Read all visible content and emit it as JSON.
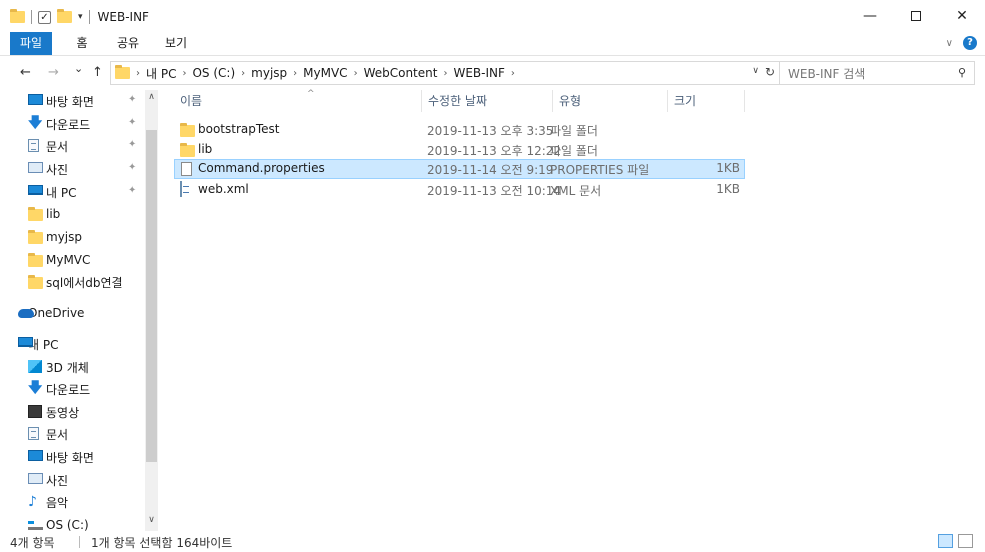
{
  "window": {
    "title": "WEB-INF",
    "minimize_label": "—",
    "maximize_label": "",
    "close_label": "✕",
    "qat_dropdown_glyph": "▾"
  },
  "ribbon": {
    "tabs": [
      {
        "label": "파일",
        "active": true
      },
      {
        "label": "홈",
        "active": false
      },
      {
        "label": "공유",
        "active": false
      },
      {
        "label": "보기",
        "active": false
      }
    ],
    "expand_glyph": "∨",
    "help_glyph": "?"
  },
  "navigation": {
    "back": "←",
    "forward": "→",
    "recent": "⌄",
    "up": "↑"
  },
  "address": {
    "crumbs": [
      "내 PC",
      "OS (C:)",
      "myjsp",
      "MyMVC",
      "WebContent",
      "WEB-INF"
    ],
    "separator": "›",
    "dropdown": "∨",
    "refresh": "↻"
  },
  "search": {
    "placeholder": "WEB-INF 검색",
    "icon": "search-icon"
  },
  "nav_pane": {
    "items": [
      {
        "label": "바탕 화면",
        "icon": "desktop-icon",
        "pinned": true
      },
      {
        "label": "다운로드",
        "icon": "download-icon",
        "pinned": true
      },
      {
        "label": "문서",
        "icon": "documents-icon",
        "pinned": true
      },
      {
        "label": "사진",
        "icon": "pictures-icon",
        "pinned": true
      },
      {
        "label": "내 PC",
        "icon": "this-pc-icon",
        "pinned": true
      },
      {
        "label": "lib",
        "icon": "folder-icon",
        "pinned": false
      },
      {
        "label": "myjsp",
        "icon": "folder-icon",
        "pinned": false
      },
      {
        "label": "MyMVC",
        "icon": "folder-icon",
        "pinned": false
      },
      {
        "label": "sql에서db연결",
        "icon": "folder-icon",
        "pinned": false
      },
      {
        "label": "OneDrive",
        "icon": "onedrive-icon",
        "pinned": false
      },
      {
        "label": "내 PC",
        "icon": "this-pc-icon",
        "pinned": false
      },
      {
        "label": "3D 개체",
        "icon": "3d-objects-icon",
        "pinned": false
      },
      {
        "label": "다운로드",
        "icon": "download-icon",
        "pinned": false
      },
      {
        "label": "동영상",
        "icon": "videos-icon",
        "pinned": false
      },
      {
        "label": "문서",
        "icon": "documents-icon",
        "pinned": false
      },
      {
        "label": "바탕 화면",
        "icon": "desktop-icon",
        "pinned": false
      },
      {
        "label": "사진",
        "icon": "pictures-icon",
        "pinned": false
      },
      {
        "label": "음악",
        "icon": "music-icon",
        "pinned": false
      },
      {
        "label": "OS (C:)",
        "icon": "drive-icon",
        "pinned": false
      }
    ],
    "pin_glyph": "📌",
    "scroll_up": "∧",
    "scroll_down": "∨"
  },
  "file_list": {
    "columns": {
      "name": "이름",
      "date": "수정한 날짜",
      "type": "유형",
      "size": "크기"
    },
    "sort_glyph": "^",
    "rows": [
      {
        "name": "bootstrapTest",
        "date": "2019-11-13 오후 3:35",
        "type": "파일 폴더",
        "size": "",
        "icon": "folder-icon",
        "selected": false
      },
      {
        "name": "lib",
        "date": "2019-11-13 오후 12:22",
        "type": "파일 폴더",
        "size": "",
        "icon": "folder-icon",
        "selected": false
      },
      {
        "name": "Command.properties",
        "date": "2019-11-14 오전 9:19",
        "type": "PROPERTIES 파일",
        "size": "1KB",
        "icon": "file-icon",
        "selected": true
      },
      {
        "name": "web.xml",
        "date": "2019-11-13 오전 10:14",
        "type": "XML 문서",
        "size": "1KB",
        "icon": "xml-file-icon",
        "selected": false
      }
    ]
  },
  "status": {
    "item_count": "4개 항목",
    "selection": "1개 항목 선택함 164바이트"
  },
  "colors": {
    "accent": "#1979ca",
    "selection_bg": "#cce8ff",
    "selection_border": "#99d1ff",
    "folder": "#ffd767"
  }
}
